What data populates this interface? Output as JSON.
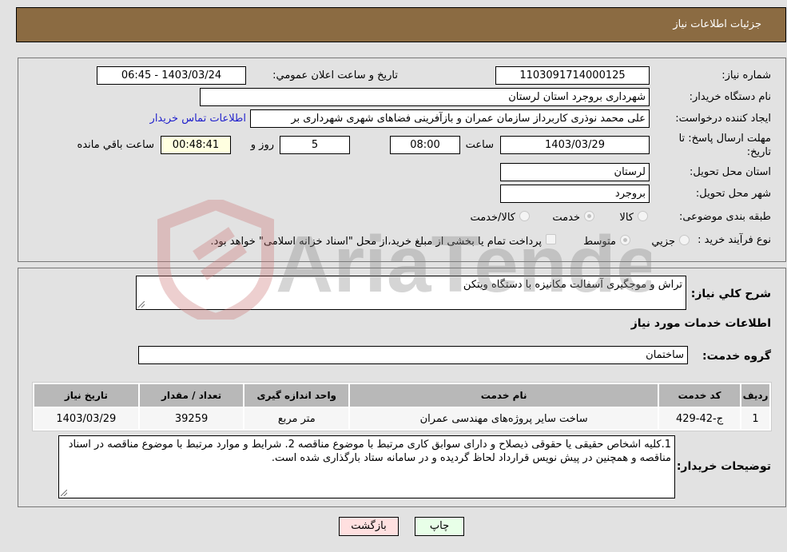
{
  "header": {
    "title": "جزئیات اطلاعات نیاز"
  },
  "details": {
    "need_number_label": "شماره نیاز:",
    "need_number": "1103091714000125",
    "announce_label": "تاریخ و ساعت اعلان عمومي:",
    "announce_value": "1403/03/24 - 06:45",
    "buyer_org_label": "نام دستگاه خریدار:",
    "buyer_org": "شهرداری بروجرد استان لرستان",
    "creator_label": "ایجاد کننده درخواست:",
    "creator": "علی محمد نوذری کاربرداز سازمان عمران و بازآفرینی فضاهای شهری شهرداری بر",
    "contact_link": "اطلاعات تماس خریدار",
    "deadline_label": "مهلت ارسال پاسخ: تا تاریخ:",
    "deadline_date": "1403/03/29",
    "time_label": "ساعت",
    "deadline_time": "08:00",
    "days_value": "5",
    "days_label": "روز و",
    "remaining_time": "00:48:41",
    "remaining_label": "ساعت باقي مانده",
    "province_label": "استان محل تحویل:",
    "province": "لرستان",
    "city_label": "شهر محل تحویل:",
    "city": "بروجرد",
    "category_label": "طبقه بندی موضوعی:",
    "category_options": [
      {
        "label": "کالا",
        "checked": false
      },
      {
        "label": "خدمت",
        "checked": true
      },
      {
        "label": "کالا/خدمت",
        "checked": false
      }
    ],
    "process_label": "نوع فرآیند خرید :",
    "process_options": [
      {
        "label": "جزيي",
        "checked": false
      },
      {
        "label": "متوسط",
        "checked": true
      }
    ],
    "treasury_note": "پرداخت تمام یا بخشی از مبلغ خرید،از محل \"اسناد خزانه اسلامی\" خواهد بود."
  },
  "description": {
    "label": "شرح کلي نياز:",
    "value": "تراش و موجگیری آسفالت مکانیزه با دستگاه ویتکن"
  },
  "services": {
    "section_title": "اطلاعات خدمات مورد نياز",
    "group_label": "گروه خدمت:",
    "group_value": "ساختمان",
    "columns": [
      "ردیف",
      "کد خدمت",
      "نام خدمت",
      "واحد اندازه گیری",
      "تعداد / مقدار",
      "تاریخ نیاز"
    ],
    "rows": [
      [
        "1",
        "ج-42-429",
        "ساخت سایر پروژه‌های مهندسی عمران",
        "متر مربع",
        "39259",
        "1403/03/29"
      ]
    ]
  },
  "buyer_notes": {
    "label": "توضیحات خریدار:",
    "value": "1.کلیه اشخاص حقیقی یا حقوقی ذیصلاح و دارای سوابق کاری مرتبط با موضوع مناقصه 2. شرایط و موارد مرتبط با موضوع مناقصه در اسناد مناقصه  و همچنین در پیش نویس قرارداد لحاظ گردیده و در سامانه ستاد بارگذاری شده است."
  },
  "buttons": {
    "print": "چاپ",
    "back": "بازگشت"
  },
  "watermark": {
    "text": "AriaTender.neT"
  }
}
